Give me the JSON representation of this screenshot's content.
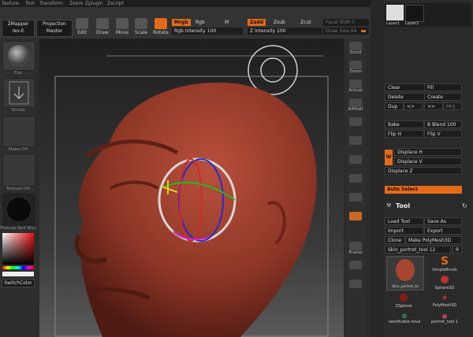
{
  "menu": [
    "Texture",
    "Tool",
    "Transform",
    "Zoom",
    "Zplugin",
    "Zscript"
  ],
  "toolbar": {
    "zmapper": "ZMapper",
    "zmapper_sub": "rev-E",
    "projection": "Projection",
    "projection_sub": "Master",
    "tools": [
      "Edit",
      "Draw",
      "Move",
      "Scale",
      "Rotate"
    ],
    "active_tool": "Rotate",
    "mrgb": "Mrgb",
    "rgb": "Rgb",
    "m": "M",
    "rgb_intensity": "Rgb Intensity",
    "rgb_intensity_value": "100",
    "zadd": "Zadd",
    "zsub": "Zsub",
    "zcut": "Zcut",
    "z_intensity": "Z Intensity",
    "z_intensity_value": "100",
    "focal_shift": "Focal Shift",
    "focal_shift_value": "0",
    "draw_size": "Draw Size",
    "draw_size_value": "64"
  },
  "left_shelf": {
    "material": "Flat",
    "alpha": "Stroke",
    "texture": "Make Off",
    "texture2": "Texture Off",
    "material2": "Matcap Red Wax",
    "switch_color": "SwitchColor"
  },
  "right_shelf": [
    "Scroll",
    "Zoom",
    "Actual",
    "AAHalf",
    "",
    "",
    "",
    "",
    "",
    "",
    "",
    "",
    "Frame",
    "",
    ""
  ],
  "layers": {
    "items": [
      "Layer1",
      "Layer2"
    ]
  },
  "layer_buttons": {
    "clear": "Clear",
    "fill": "Fill",
    "delete": "Delete",
    "create": "Create",
    "dup": "Dup",
    "merge": "Mrg"
  },
  "bake": {
    "bake": "Bake",
    "b_blend": "B Blend",
    "b_blend_value": "100",
    "flip_h": "Flip H",
    "flip_v": "Flip V"
  },
  "displace": {
    "w": "W",
    "h": "Displace H",
    "v": "Displace V",
    "z": "Displace Z"
  },
  "auto_select": "Auto Select",
  "tool_panel": {
    "title": "Tool",
    "load": "Load Tool",
    "save": "Save As",
    "import": "Import",
    "export": "Export",
    "clone": "Clone",
    "make_poly": "Make PolyMesh3D",
    "current": "Skin_portret_tool 12",
    "r": "R",
    "thumbs": [
      "SimpleBrush",
      "Sphere3D",
      "ZSphere",
      "PolyMesh3D",
      "ramificatie nova",
      "portret_tool 1"
    ],
    "current_thumb": "Skin_portret_to"
  },
  "colors": {
    "accent": "#e36a18",
    "head": "#9b3a2a"
  }
}
